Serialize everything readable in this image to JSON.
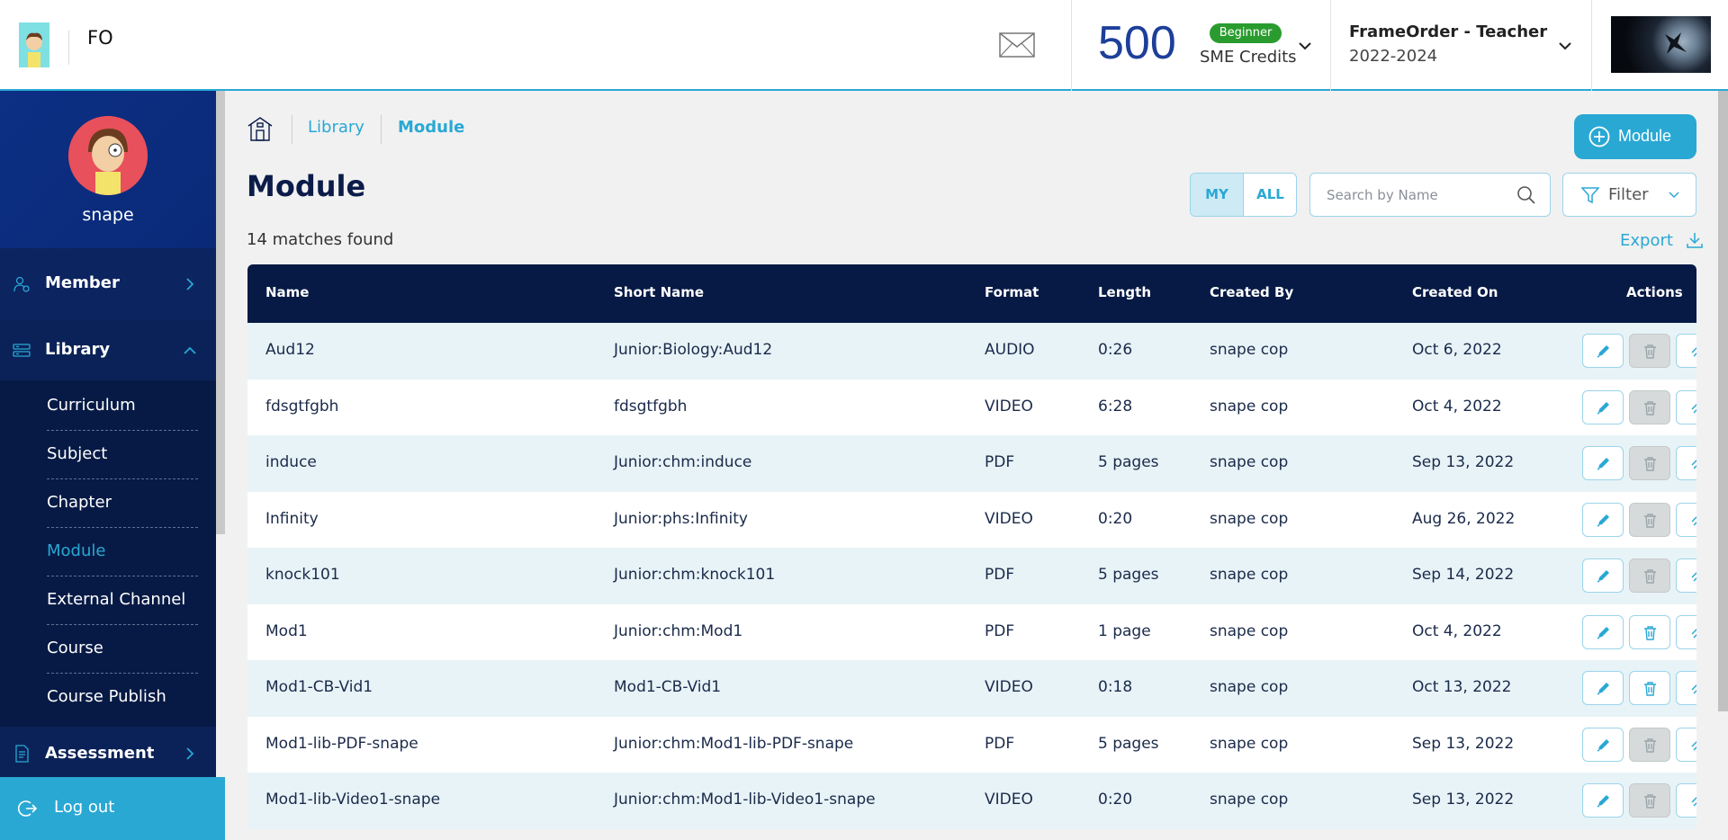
{
  "header": {
    "brand": "FO",
    "credits_value": "500",
    "credits_level": "Beginner",
    "credits_label": "SME Credits",
    "org_name": "FrameOrder - Teacher",
    "org_year": "2022-2024"
  },
  "sidebar": {
    "username": "snape",
    "member_label": "Member",
    "library_label": "Library",
    "library_items": [
      {
        "label": "Curriculum",
        "active": false
      },
      {
        "label": "Subject",
        "active": false
      },
      {
        "label": "Chapter",
        "active": false
      },
      {
        "label": "Module",
        "active": true
      },
      {
        "label": "External Channel",
        "active": false
      },
      {
        "label": "Course",
        "active": false
      },
      {
        "label": "Course Publish",
        "active": false
      }
    ],
    "assessment_label": "Assessment",
    "logout_label": "Log out"
  },
  "breadcrumb": {
    "library": "Library",
    "current": "Module"
  },
  "page": {
    "title": "Module",
    "add_button": "Module",
    "matches": "14 matches found",
    "toggle_my": "MY",
    "toggle_all": "ALL",
    "search_placeholder": "Search by Name",
    "filter_label": "Filter",
    "export_label": "Export"
  },
  "table": {
    "headers": [
      "Name",
      "Short Name",
      "Format",
      "Length",
      "Created By",
      "Created On",
      "Actions"
    ],
    "rows": [
      {
        "name": "Aud12",
        "short": "Junior:Biology:Aud12",
        "format": "AUDIO",
        "length": "0:26",
        "by": "snape cop",
        "on": "Oct 6, 2022",
        "del_disabled": true
      },
      {
        "name": "fdsgtfgbh",
        "short": "fdsgtfgbh",
        "format": "VIDEO",
        "length": "6:28",
        "by": "snape cop",
        "on": "Oct 4, 2022",
        "del_disabled": true
      },
      {
        "name": "induce",
        "short": "Junior:chm:induce",
        "format": "PDF",
        "length": "5 pages",
        "by": "snape cop",
        "on": "Sep 13, 2022",
        "del_disabled": true
      },
      {
        "name": "Infinity",
        "short": "Junior:phs:Infinity",
        "format": "VIDEO",
        "length": "0:20",
        "by": "snape cop",
        "on": "Aug 26, 2022",
        "del_disabled": true
      },
      {
        "name": "knock101",
        "short": "Junior:chm:knock101",
        "format": "PDF",
        "length": "5 pages",
        "by": "snape cop",
        "on": "Sep 14, 2022",
        "del_disabled": true
      },
      {
        "name": "Mod1",
        "short": "Junior:chm:Mod1",
        "format": "PDF",
        "length": "1 page",
        "by": "snape cop",
        "on": "Oct 4, 2022",
        "del_disabled": false
      },
      {
        "name": "Mod1-CB-Vid1",
        "short": "Mod1-CB-Vid1",
        "format": "VIDEO",
        "length": "0:18",
        "by": "snape cop",
        "on": "Oct 13, 2022",
        "del_disabled": false
      },
      {
        "name": "Mod1-lib-PDF-snape",
        "short": "Junior:chm:Mod1-lib-PDF-snape",
        "format": "PDF",
        "length": "5 pages",
        "by": "snape cop",
        "on": "Sep 13, 2022",
        "del_disabled": true
      },
      {
        "name": "Mod1-lib-Video1-snape",
        "short": "Junior:chm:Mod1-lib-Video1-snape",
        "format": "VIDEO",
        "length": "0:20",
        "by": "snape cop",
        "on": "Sep 13, 2022",
        "del_disabled": true
      }
    ]
  },
  "icons": {
    "mail": "mail-icon",
    "chevron": "chevron-down-icon",
    "home": "home-icon",
    "search": "search-icon",
    "filter": "filter-icon",
    "export": "download-icon",
    "edit": "pencil-icon",
    "delete": "trash-icon",
    "logout": "logout-icon"
  },
  "colors": {
    "accent": "#29a8d4",
    "navy": "#071a45",
    "badge": "#2a9c2f"
  }
}
